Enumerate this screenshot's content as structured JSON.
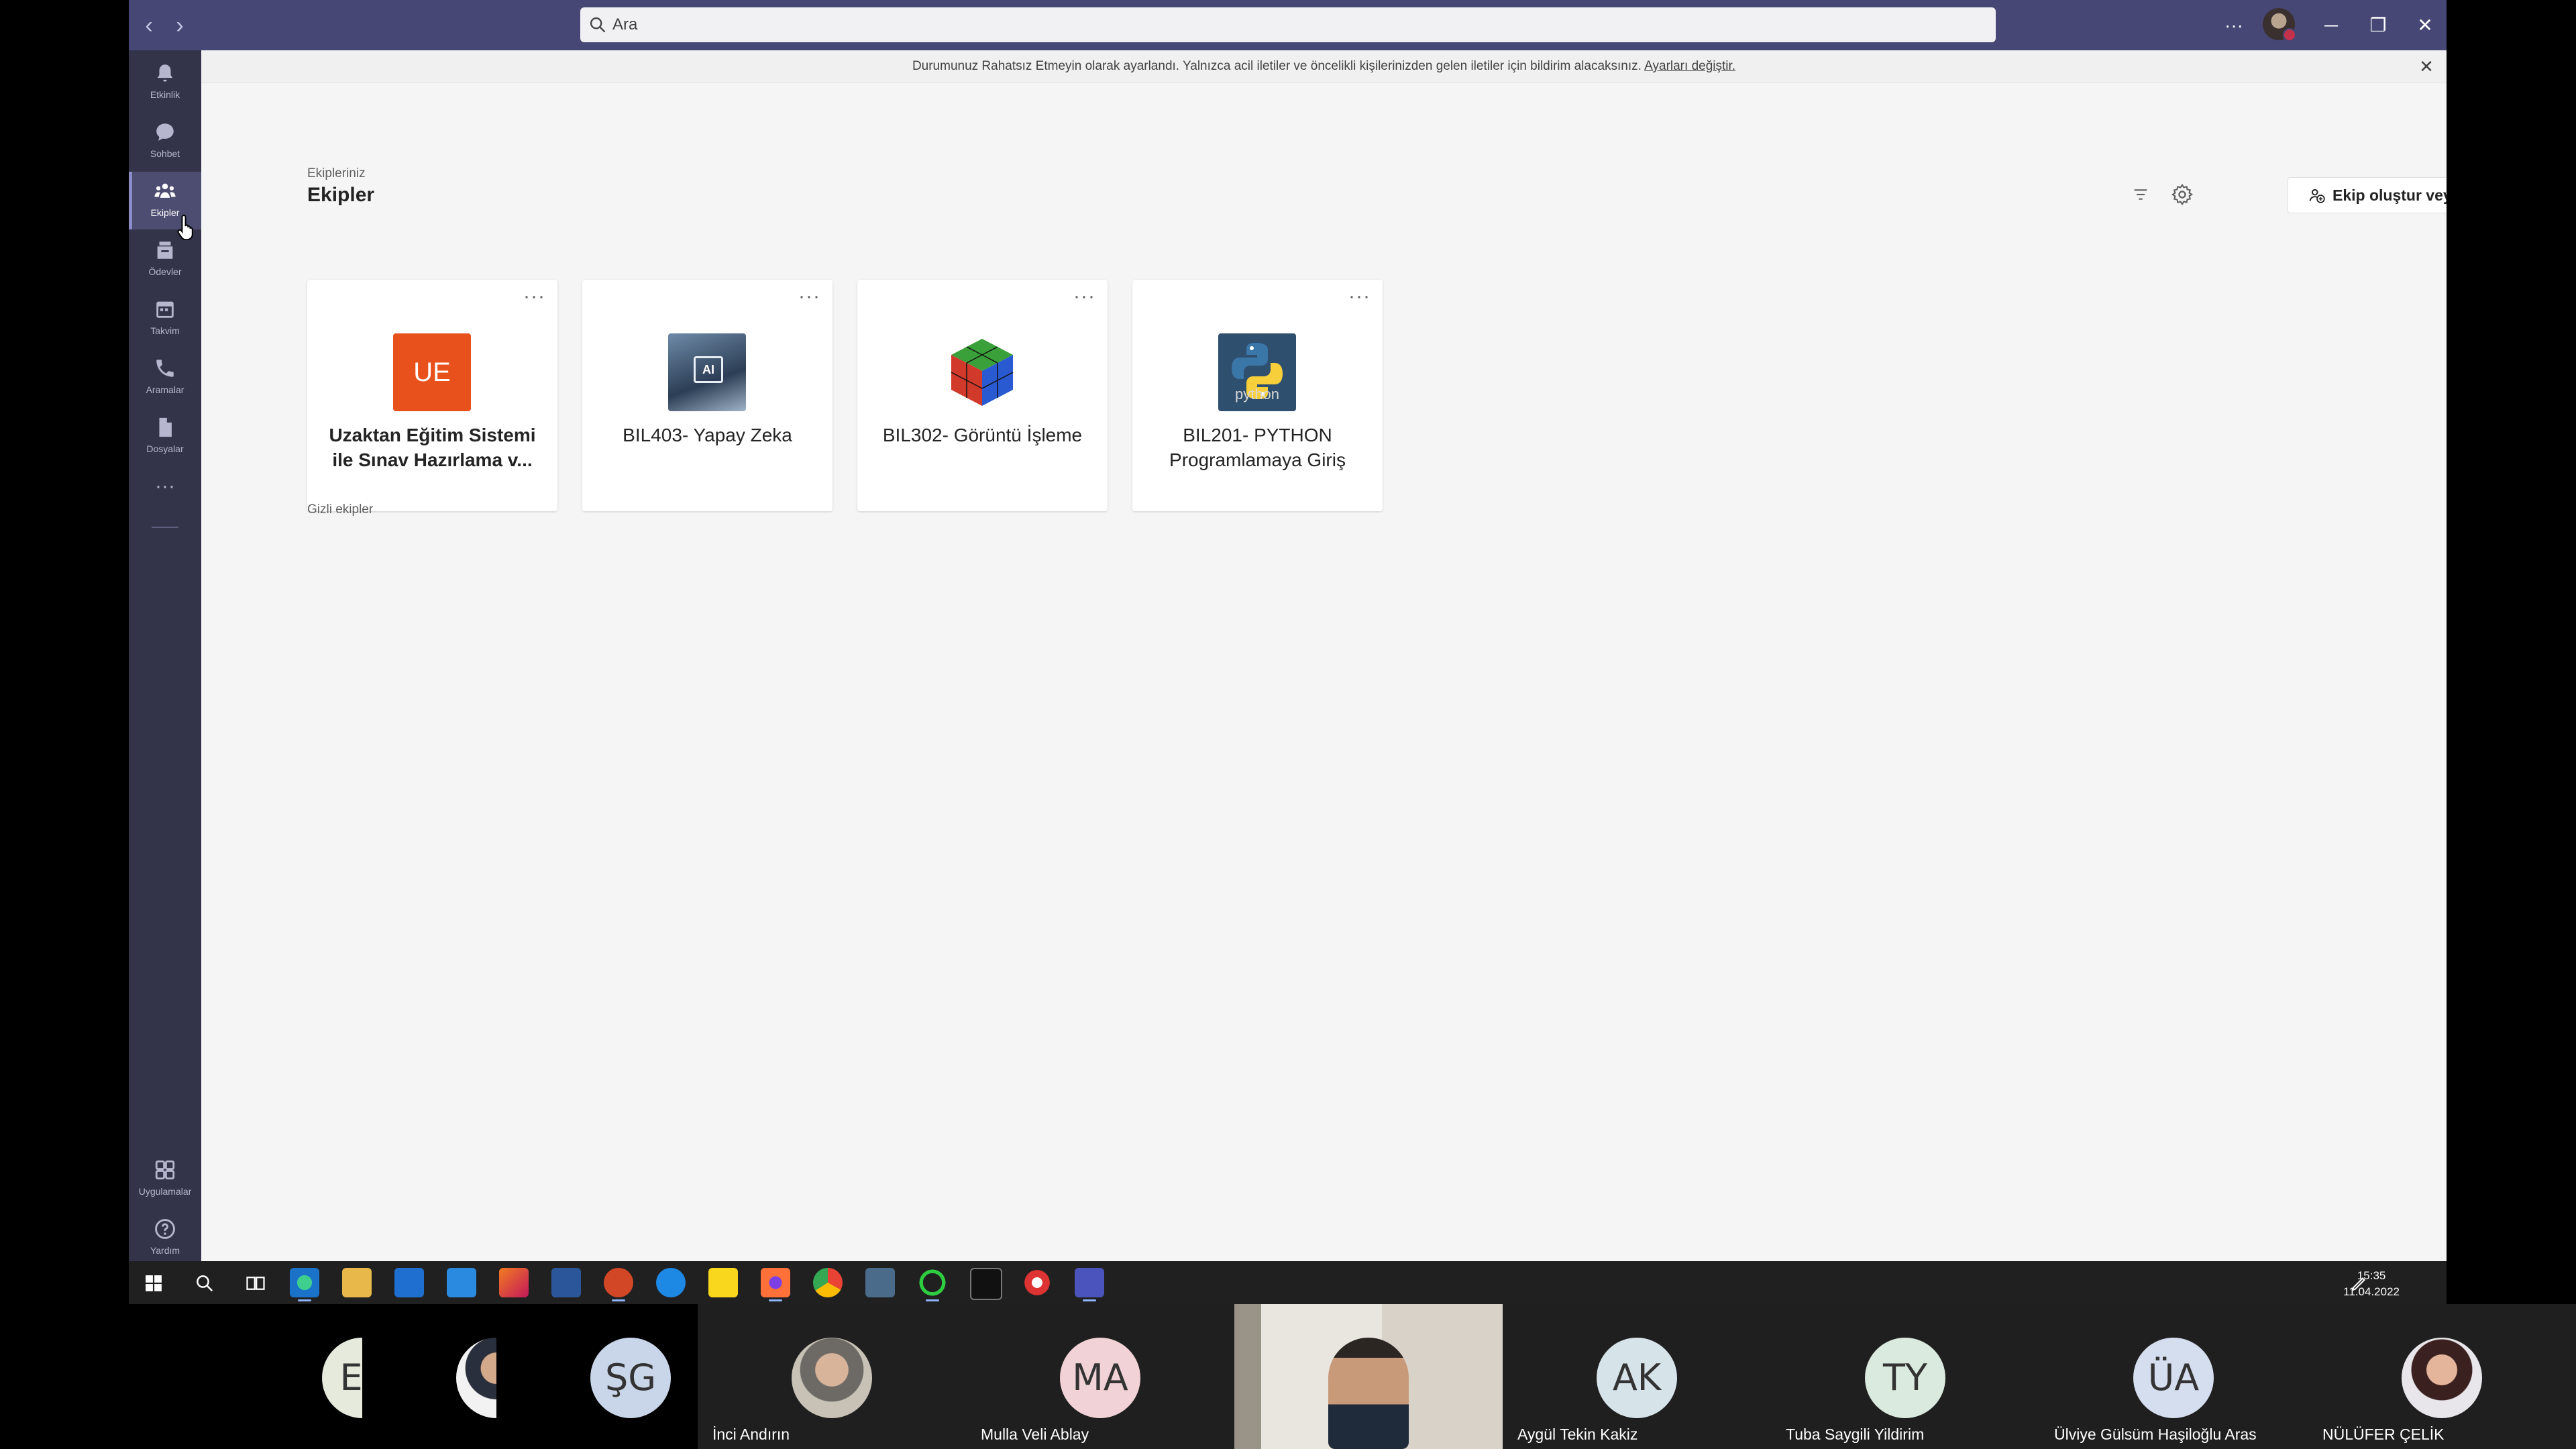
{
  "search": {
    "placeholder": "Ara"
  },
  "titlebar": {
    "more": "···",
    "minimize": "─",
    "restore": "❐",
    "close": "✕"
  },
  "rail": [
    {
      "label": "Etkinlik",
      "icon": "bell-icon"
    },
    {
      "label": "Sohbet",
      "icon": "chat-icon"
    },
    {
      "label": "Ekipler",
      "icon": "teams-icon",
      "active": true
    },
    {
      "label": "Ödevler",
      "icon": "assignments-icon"
    },
    {
      "label": "Takvim",
      "icon": "calendar-icon"
    },
    {
      "label": "Aramalar",
      "icon": "phone-icon"
    },
    {
      "label": "Dosyalar",
      "icon": "file-icon"
    },
    {
      "label": "Uygulamalar",
      "icon": "apps-icon"
    },
    {
      "label": "Yardım",
      "icon": "help-icon"
    }
  ],
  "notice": {
    "text": "Durumunuz Rahatsız Etmeyin olarak ayarlandı. Yalnızca acil iletiler ve öncelikli kişilerinizden gelen iletiler için bildirim alacaksınız.",
    "link": "Ayarları değiştir."
  },
  "header": {
    "title": "Ekipler",
    "create_label": "Ekip oluştur veya bir ekibe katıl"
  },
  "sections": {
    "your_teams": "Ekipleriniz",
    "hidden_teams": "Gizli ekipler"
  },
  "teams": [
    {
      "name": "Uzaktan Eğitim Sistemi ile Sınav Hazırlama v...",
      "initials": "UE",
      "color": "#e8501c"
    },
    {
      "name": "BIL403- Yapay Zeka",
      "initials": "AI"
    },
    {
      "name": "BIL302- Görüntü İşleme"
    },
    {
      "name": "BIL201- PYTHON Programlamaya Giriş",
      "logo_text": "python"
    }
  ],
  "clock": {
    "time": "15:35",
    "date": "11.04.2022"
  },
  "participants": [
    {
      "initials": "ET",
      "name": ""
    },
    {
      "initials": "",
      "name": "",
      "photo": true
    },
    {
      "initials": "ŞG",
      "name": ""
    },
    {
      "initials": "",
      "name": "İnci Andırın",
      "photo": true
    },
    {
      "initials": "MA",
      "name": "Mulla Veli Ablay"
    },
    {
      "initials": "",
      "name": "",
      "video": true
    },
    {
      "initials": "AK",
      "name": "Aygül Tekin Kakiz"
    },
    {
      "initials": "TY",
      "name": "Tuba Saygili Yildirim"
    },
    {
      "initials": "ÜA",
      "name": "Ülviye Gülsüm Haşiloğlu Aras"
    },
    {
      "initials": "",
      "name": "NÜLÜFER ÇELİK",
      "photo": true
    }
  ]
}
